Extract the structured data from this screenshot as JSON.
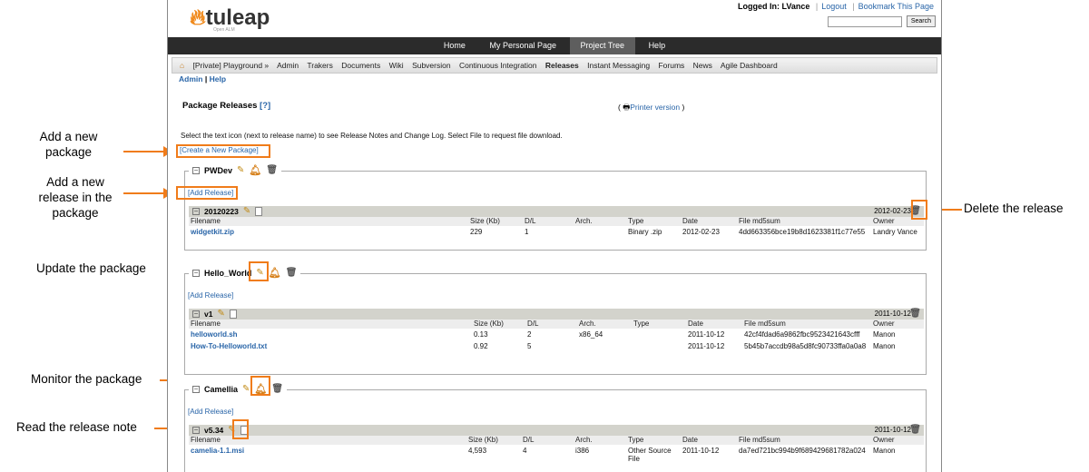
{
  "callouts": {
    "add_package": "Add a new package",
    "add_release": "Add a new release in the package",
    "update_package": "Update the package",
    "monitor_package": "Monitor the package",
    "read_release_note": "Read the release note",
    "delete_release": "Delete the release"
  },
  "header": {
    "logo": "tuleap",
    "logo_sub": "Open ALM",
    "logged_in_label": "Logged In:",
    "user": "LVance",
    "logout": "Logout",
    "bookmark": "Bookmark This Page",
    "search_button": "Search"
  },
  "topnav": [
    "Home",
    "My Personal Page",
    "Project Tree",
    "Help"
  ],
  "secnav": [
    "[Private] Playground »",
    "Admin",
    "Trakers",
    "Documents",
    "Wiki",
    "Subversion",
    "Continuous Integration",
    "Releases",
    "Instant Messaging",
    "Forums",
    "News",
    "Agile Dashboard"
  ],
  "admin": "Admin",
  "help": "Help",
  "page_title": "Package Releases",
  "help_q": "[?]",
  "printer_open": "(",
  "printer": "Printer version",
  "printer_close": ")",
  "instructions": "Select the text icon (next to release name) to see Release Notes and Change Log. Select File to request file download.",
  "create_package": "[Create a New Package]",
  "add_release": "[Add Release]",
  "columns": [
    "Filename",
    "Size (Kb)",
    "D/L",
    "Arch.",
    "Type",
    "Date",
    "File md5sum",
    "Owner"
  ],
  "packages": [
    {
      "name": "PWDev",
      "release": "20120223",
      "release_date": "2012-02-23",
      "files": [
        {
          "filename": "widgetkit.zip",
          "size": "229",
          "dl": "1",
          "arch": "",
          "type": "Binary .zip",
          "date": "2012-02-23",
          "md5": "4dd663356bce19b8d1623381f1c77e55",
          "owner": "Landry Vance"
        }
      ]
    },
    {
      "name": "Hello_World",
      "release": "v1",
      "release_date": "2011-10-12",
      "files": [
        {
          "filename": "helloworld.sh",
          "size": "0.13",
          "dl": "2",
          "arch": "x86_64",
          "type": "",
          "date": "2011-10-12",
          "md5": "42cf4fdad6a9862fbc9523421643cfff",
          "owner": "Manon"
        },
        {
          "filename": "How-To-Helloworld.txt",
          "size": "0.92",
          "dl": "5",
          "arch": "",
          "type": "",
          "date": "2011-10-12",
          "md5": "5b45b7accdb98a5d8fc90733ffa0a0a8",
          "owner": "Manon"
        }
      ]
    },
    {
      "name": "Camellia",
      "release": "v5.34",
      "release_date": "2011-10-12",
      "files": [
        {
          "filename": "camelia-1.1.msi",
          "size": "4,593",
          "dl": "4",
          "arch": "i386",
          "type": "Other Source File",
          "date": "2011-10-12",
          "md5": "da7ed721bc994b9f689429681782a024",
          "owner": "Manon"
        }
      ]
    }
  ],
  "colors": {
    "accent_orange": "#f07c1a",
    "link_blue": "#2965a8",
    "nav_dark": "#2b2b2b"
  }
}
